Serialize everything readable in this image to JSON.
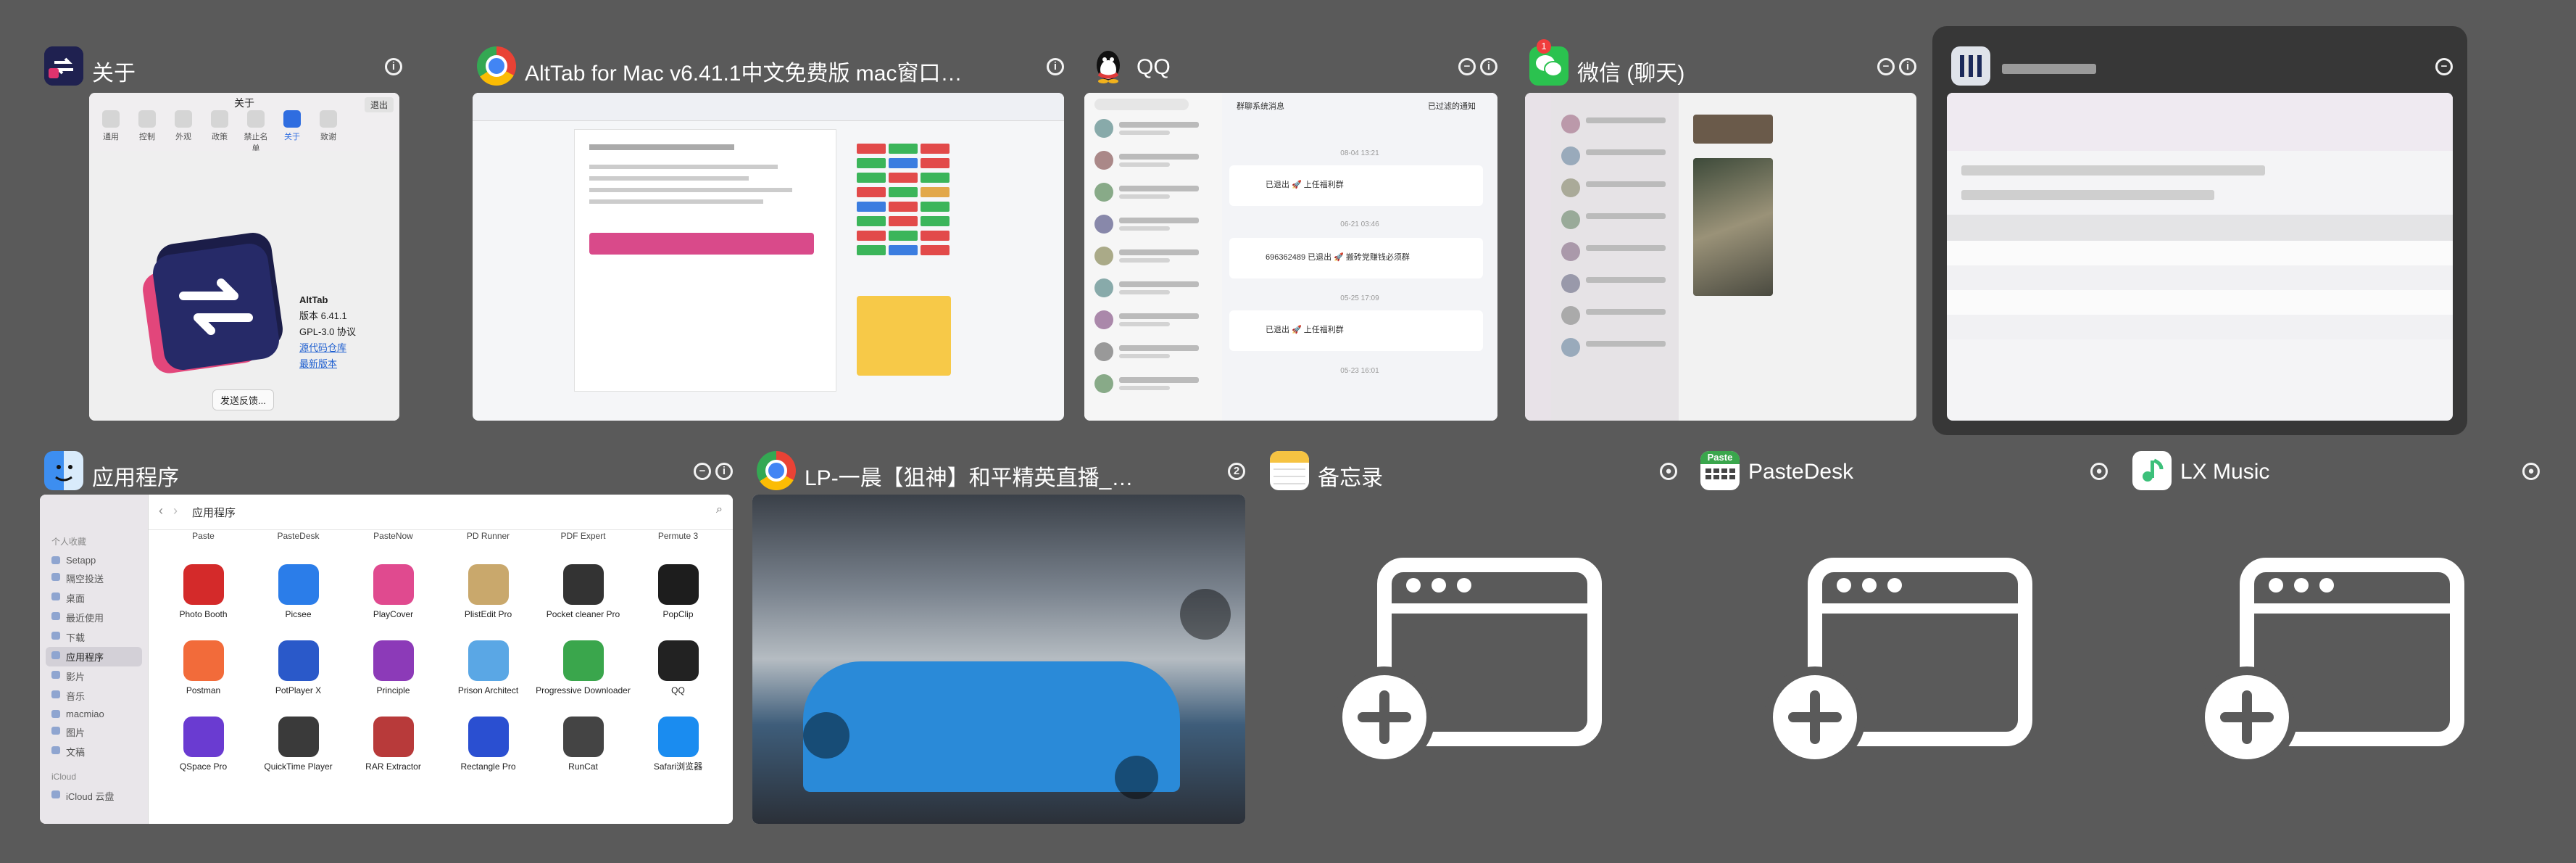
{
  "windows_row1": [
    {
      "title": "关于",
      "badge_icons": [
        "info-icon"
      ]
    },
    {
      "title": "AltTab for Mac v6.41.1中文免费版 mac窗口快速...",
      "badge_icons": [
        "info-icon"
      ]
    },
    {
      "title": "QQ",
      "badge_icons": [
        "minimize-icon",
        "info-icon"
      ]
    },
    {
      "title": "微信 (聊天)",
      "app_badge": "1",
      "badge_icons": [
        "minimize-icon",
        "info-icon"
      ]
    },
    {
      "title": "",
      "selected": true,
      "badge_icons": [
        "minimize-icon"
      ]
    }
  ],
  "windows_row2": [
    {
      "title": "应用程序",
      "badge_icons": [
        "minimize-icon",
        "info-icon"
      ]
    },
    {
      "title": "LP-一晨【狙神】和平精英直播_LP-一...",
      "count": "2"
    },
    {
      "title": "备忘录",
      "no_window": true
    },
    {
      "title": "PasteDesk",
      "no_window": true,
      "icon_label": "Paste"
    },
    {
      "title": "LX Music",
      "no_window": true
    }
  ],
  "about": {
    "window_title": "关于",
    "exit": "退出",
    "tabs": [
      "通用",
      "控制",
      "外观",
      "政策",
      "禁止名单",
      "关于",
      "致谢"
    ],
    "app_name": "AltTab",
    "version": "版本 6.41.1",
    "license": "GPL-3.0 协议",
    "link_repo": "源代码仓库",
    "link_latest": "最新版本",
    "feedback": "发送反馈..."
  },
  "qq": {
    "header": "群聊系统消息",
    "filter": "已过滤的通知",
    "times": [
      "08-04 13:21",
      "06-21 03:46",
      "05-25 17:09",
      "05-23 16:01"
    ],
    "msgs": [
      "已退出 🚀 上任福利群",
      "696362489 已退出 🚀 搬砖党赚钱必须群",
      "已退出 🚀 上任福利群"
    ]
  },
  "finder": {
    "title": "应用程序",
    "side_group": "个人收藏",
    "side_items": [
      "Setapp",
      "隔空投送",
      "桌面",
      "最近使用",
      "下载",
      "应用程序",
      "影片",
      "音乐",
      "macmiao",
      "图片",
      "文稿"
    ],
    "icloud_group": "iCloud",
    "icloud_items": [
      "iCloud 云盘"
    ],
    "top_labels": [
      "Paste",
      "PasteDesk",
      "PasteNow",
      "PD Runner",
      "PDF Expert",
      "Permute 3"
    ],
    "apps": [
      {
        "name": "Photo Booth",
        "color": "#d42a2a"
      },
      {
        "name": "Picsee",
        "color": "#2b7de9"
      },
      {
        "name": "PlayCover",
        "color": "#e04a8f"
      },
      {
        "name": "PlistEdit Pro",
        "color": "#c9a86c"
      },
      {
        "name": "Pocket cleaner Pro",
        "color": "#333333"
      },
      {
        "name": "PopClip",
        "color": "#1d1d1d"
      },
      {
        "name": "Postman",
        "color": "#f26b3a"
      },
      {
        "name": "PotPlayer X",
        "color": "#2a59c9"
      },
      {
        "name": "Principle",
        "color": "#8c3ab8"
      },
      {
        "name": "Prison Architect",
        "color": "#5aa7e5"
      },
      {
        "name": "Progressive Downloader",
        "color": "#3aa64c"
      },
      {
        "name": "QQ",
        "color": "#222222"
      },
      {
        "name": "QSpace Pro",
        "color": "#6a3bd1"
      },
      {
        "name": "QuickTime Player",
        "color": "#3a3a3a"
      },
      {
        "name": "RAR Extractor",
        "color": "#b83a3a"
      },
      {
        "name": "Rectangle Pro",
        "color": "#2a4fd1"
      },
      {
        "name": "RunCat",
        "color": "#444444"
      },
      {
        "name": "Safari浏览器",
        "color": "#1a8cf0"
      }
    ]
  },
  "colors": {
    "background": "#5a5a5a",
    "selected_card": "#2a2a2a"
  }
}
